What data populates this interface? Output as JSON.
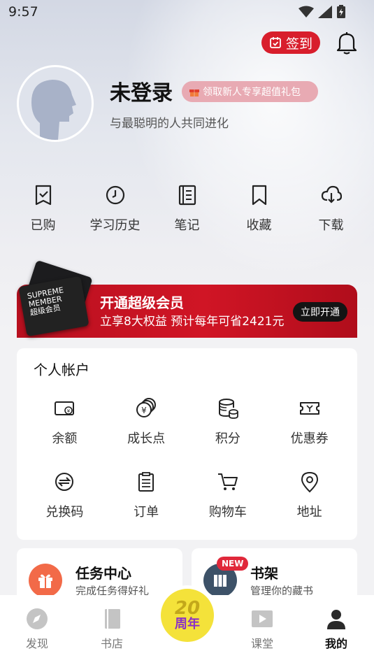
{
  "status_bar": {
    "time": "9:57"
  },
  "header": {
    "signin_label": "签到"
  },
  "profile": {
    "username": "未登录",
    "gift_tag": "领取新人专享超值礼包",
    "slogan": "与最聪明的人共同进化"
  },
  "quick_actions": [
    {
      "label": "已购",
      "icon": "purchased-icon"
    },
    {
      "label": "学习历史",
      "icon": "clock-icon"
    },
    {
      "label": "笔记",
      "icon": "notebook-icon"
    },
    {
      "label": "收藏",
      "icon": "bookmark-icon"
    },
    {
      "label": "下载",
      "icon": "cloud-download-icon"
    }
  ],
  "vip_banner": {
    "card_line1": "SUPREME",
    "card_line2": "MEMBER",
    "card_line3": "超级会员",
    "title": "开通超级会员",
    "subtitle": "立享8大权益 预计每年可省2421元",
    "button": "立即开通"
  },
  "account": {
    "title": "个人帐户",
    "items": [
      {
        "label": "余额",
        "icon": "wallet-icon"
      },
      {
        "label": "成长点",
        "icon": "coins-icon"
      },
      {
        "label": "积分",
        "icon": "points-icon"
      },
      {
        "label": "优惠券",
        "icon": "coupon-icon"
      },
      {
        "label": "兑换码",
        "icon": "exchange-icon"
      },
      {
        "label": "订单",
        "icon": "order-icon"
      },
      {
        "label": "购物车",
        "icon": "cart-icon"
      },
      {
        "label": "地址",
        "icon": "location-icon"
      }
    ]
  },
  "cards": {
    "task": {
      "title": "任务中心",
      "subtitle": "完成任务得好礼"
    },
    "shelf": {
      "title": "书架",
      "subtitle": "管理你的藏书",
      "badge": "NEW"
    }
  },
  "tabbar": {
    "tabs": [
      {
        "label": "发现"
      },
      {
        "label": "书店"
      },
      {
        "label": "课堂"
      },
      {
        "label": "我的"
      }
    ],
    "anniversary": {
      "number": "20",
      "label": "周年"
    }
  },
  "colors": {
    "brand_red": "#d81e2c",
    "anniversary_yellow": "#f4e23a"
  }
}
